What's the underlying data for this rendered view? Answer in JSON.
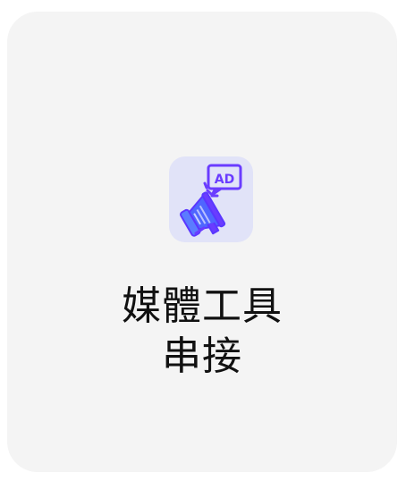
{
  "card": {
    "title_line1": "媒體工具",
    "title_line2": "串接",
    "icon": "megaphone-ad-icon",
    "ad_label": "AD"
  }
}
